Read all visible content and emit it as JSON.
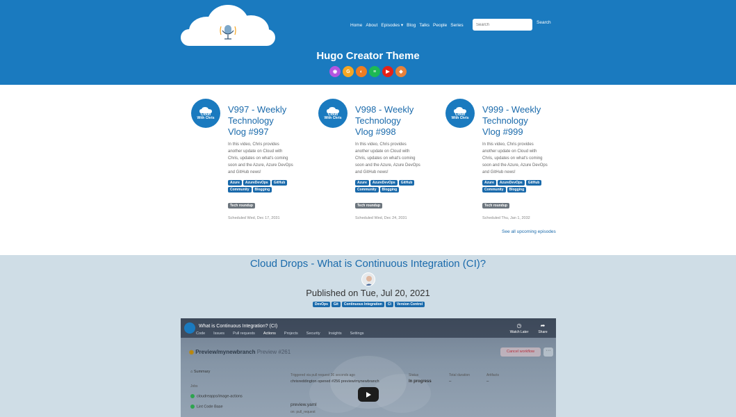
{
  "header": {
    "nav": [
      "Home",
      "About",
      "Episodes",
      "Blog",
      "Talks",
      "People",
      "Series"
    ],
    "search_placeholder": "Search",
    "search_button": "Search",
    "site_title": "Hugo Creator Theme",
    "social_icons": [
      {
        "name": "podcast-icon",
        "color": "#b355e0",
        "glyph": "◉"
      },
      {
        "name": "google-icon",
        "color": "#f5a623",
        "glyph": "G"
      },
      {
        "name": "rss-icon",
        "color": "#f07c22",
        "glyph": "◐"
      },
      {
        "name": "spotify-icon",
        "color": "#1db954",
        "glyph": "≡"
      },
      {
        "name": "youtube-icon",
        "color": "#e62117",
        "glyph": "▶"
      },
      {
        "name": "website-icon",
        "color": "#e8813a",
        "glyph": "◆"
      }
    ]
  },
  "episodes": [
    {
      "logo_text": [
        "Cloud",
        "With Chris"
      ],
      "title": "V997 - Weekly Technology Vlog #997",
      "description": "In this video, Chris provides another update on Cloud with Chris, updates on what's coming soon and the Azure, Azure DevOps and GitHub news!",
      "tags": [
        "Azure",
        "AzureDevOps",
        "GitHub",
        "Community",
        "Blogging"
      ],
      "category": "Tech roundup",
      "scheduled": "Scheduled Wed, Dec 17, 2031"
    },
    {
      "logo_text": [
        "Cloud",
        "With Chris"
      ],
      "title": "V998 - Weekly Technology Vlog #998",
      "description": "In this video, Chris provides another update on Cloud with Chris, updates on what's coming soon and the Azure, Azure DevOps and GitHub news!",
      "tags": [
        "Azure",
        "AzureDevOps",
        "GitHub",
        "Community",
        "Blogging"
      ],
      "category": "Tech roundup",
      "scheduled": "Scheduled Wed, Dec 24, 2031"
    },
    {
      "logo_text": [
        "Cloud",
        "With Chris"
      ],
      "title": "V999 - Weekly Technology Vlog #999",
      "description": "In this video, Chris provides another update on Cloud with Chris, updates on what's coming soon and the Azure, Azure DevOps and GitHub news!",
      "tags": [
        "Azure",
        "AzureDevOps",
        "GitHub",
        "Community",
        "Blogging"
      ],
      "category": "Tech roundup",
      "scheduled": "Scheduled Thu, Jan 1, 2032"
    }
  ],
  "see_all": "See all upcoming episodes",
  "featured": {
    "title": "Cloud Drops - What is Continuous Integration (CI)?",
    "published": "Published on Tue, Jul 20, 2021",
    "tags": [
      "DevOps",
      "Git",
      "Continuous Integration",
      "CI",
      "Version Control"
    ],
    "video": {
      "title": "What is Continuous Integration? (CI)",
      "watch_later": "Watch Later",
      "share": "Share",
      "repo_tabs": [
        "Code",
        "Issues",
        "Pull requests",
        "Actions",
        "Projects",
        "Security",
        "Insights",
        "Settings"
      ],
      "run_branch": "Preview/mynewbranch",
      "run_number": "Preview #261",
      "cancel": "Cancel workflow",
      "summary": "Summary",
      "jobs_label": "Jobs",
      "jobs": [
        "cloudreapps/image-actions",
        "Lint Code Base"
      ],
      "triggered": "Triggered via pull request 36 seconds ago",
      "opened_by": "chrisreddington opened #256 preview/mynewbranch",
      "status_label": "Status",
      "status": "In progress",
      "duration_label": "Total duration",
      "duration": "–",
      "artifacts_label": "Artifacts",
      "artifacts": "–",
      "workflow_file": "preview.yaml",
      "workflow_trigger": "on: pull_request"
    }
  },
  "colors": {
    "brand_blue": "#1a7abf",
    "link_blue": "#1a6aab",
    "featured_bg": "#cfdde6",
    "category_gray": "#6c757d"
  }
}
